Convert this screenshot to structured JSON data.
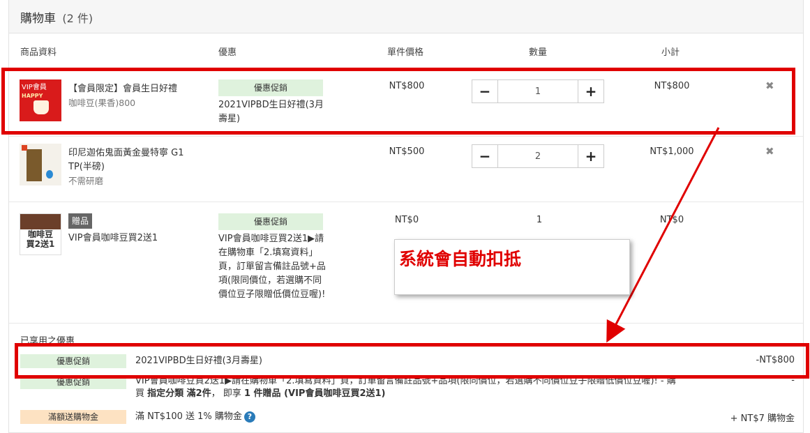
{
  "cart": {
    "title": "購物車",
    "count": "(2 件)"
  },
  "columns": {
    "product": "商品資料",
    "promo": "優惠",
    "unit_price": "單件價格",
    "quantity": "數量",
    "subtotal": "小計"
  },
  "items": [
    {
      "thumb_text": "VIP會員",
      "thumb_text2": "HAPPY",
      "name": "【會員限定】會員生日好禮",
      "variant": "咖啡豆(果香)800",
      "promo_tag": "優惠促銷",
      "promo_desc": "2021VIPBD生日好禮(3月壽星)",
      "price": "NT$800",
      "qty": "1",
      "subtotal": "NT$800"
    },
    {
      "name": "印尼迦佑鬼面黃金曼特寧 G1 TP(半磅)",
      "variant": "不需研磨",
      "price": "NT$500",
      "qty": "2",
      "subtotal": "NT$1,000"
    },
    {
      "thumb_text": "咖啡豆",
      "thumb_text2": "買2送1",
      "badge": "贈品",
      "name": "VIP會員咖啡豆買2送1",
      "promo_tag": "優惠促銷",
      "promo_desc": "VIP會員咖啡豆買2送1▶請在購物車「2.填寫資料」頁，訂單留言備註品號+品項(限同價位，若選購不同價位豆子限贈低價位豆喔)!",
      "price": "NT$0",
      "qty": "1",
      "subtotal": "NT$0"
    }
  ],
  "applied": {
    "title": "已享用之優惠",
    "rows": [
      {
        "tag": "優惠促銷",
        "text": "2021VIPBD生日好禮(3月壽星)",
        "amount": "-NT$800"
      },
      {
        "tag": "優惠促銷",
        "text_a": "VIP會員咖啡豆買2送1▶請在購物車「2.填寫資料」頁，訂單留言備註品號+品項(限同價位，若選購不同價位豆子限贈低價位豆喔)! - 購",
        "text_b1": "買 ",
        "text_b2": "指定分類 滿2件",
        "text_b3": "， 即享 ",
        "text_b4": "1 件贈品 (VIP會員咖啡豆買2送1)",
        "amount": "-"
      },
      {
        "tag": "滿額送購物金",
        "text": "滿 NT$100 送 1% 購物金",
        "amount": "+ NT$7 購物金"
      }
    ]
  },
  "annotation": {
    "callout": "系統會自動扣抵"
  },
  "colors": {
    "highlight": "#e00000",
    "promo_bg": "#dff2dd",
    "reward_bg": "#fde2c2"
  },
  "icons": {
    "remove": "close-icon",
    "plus": "plus-icon",
    "minus": "minus-icon",
    "help": "question-icon"
  }
}
